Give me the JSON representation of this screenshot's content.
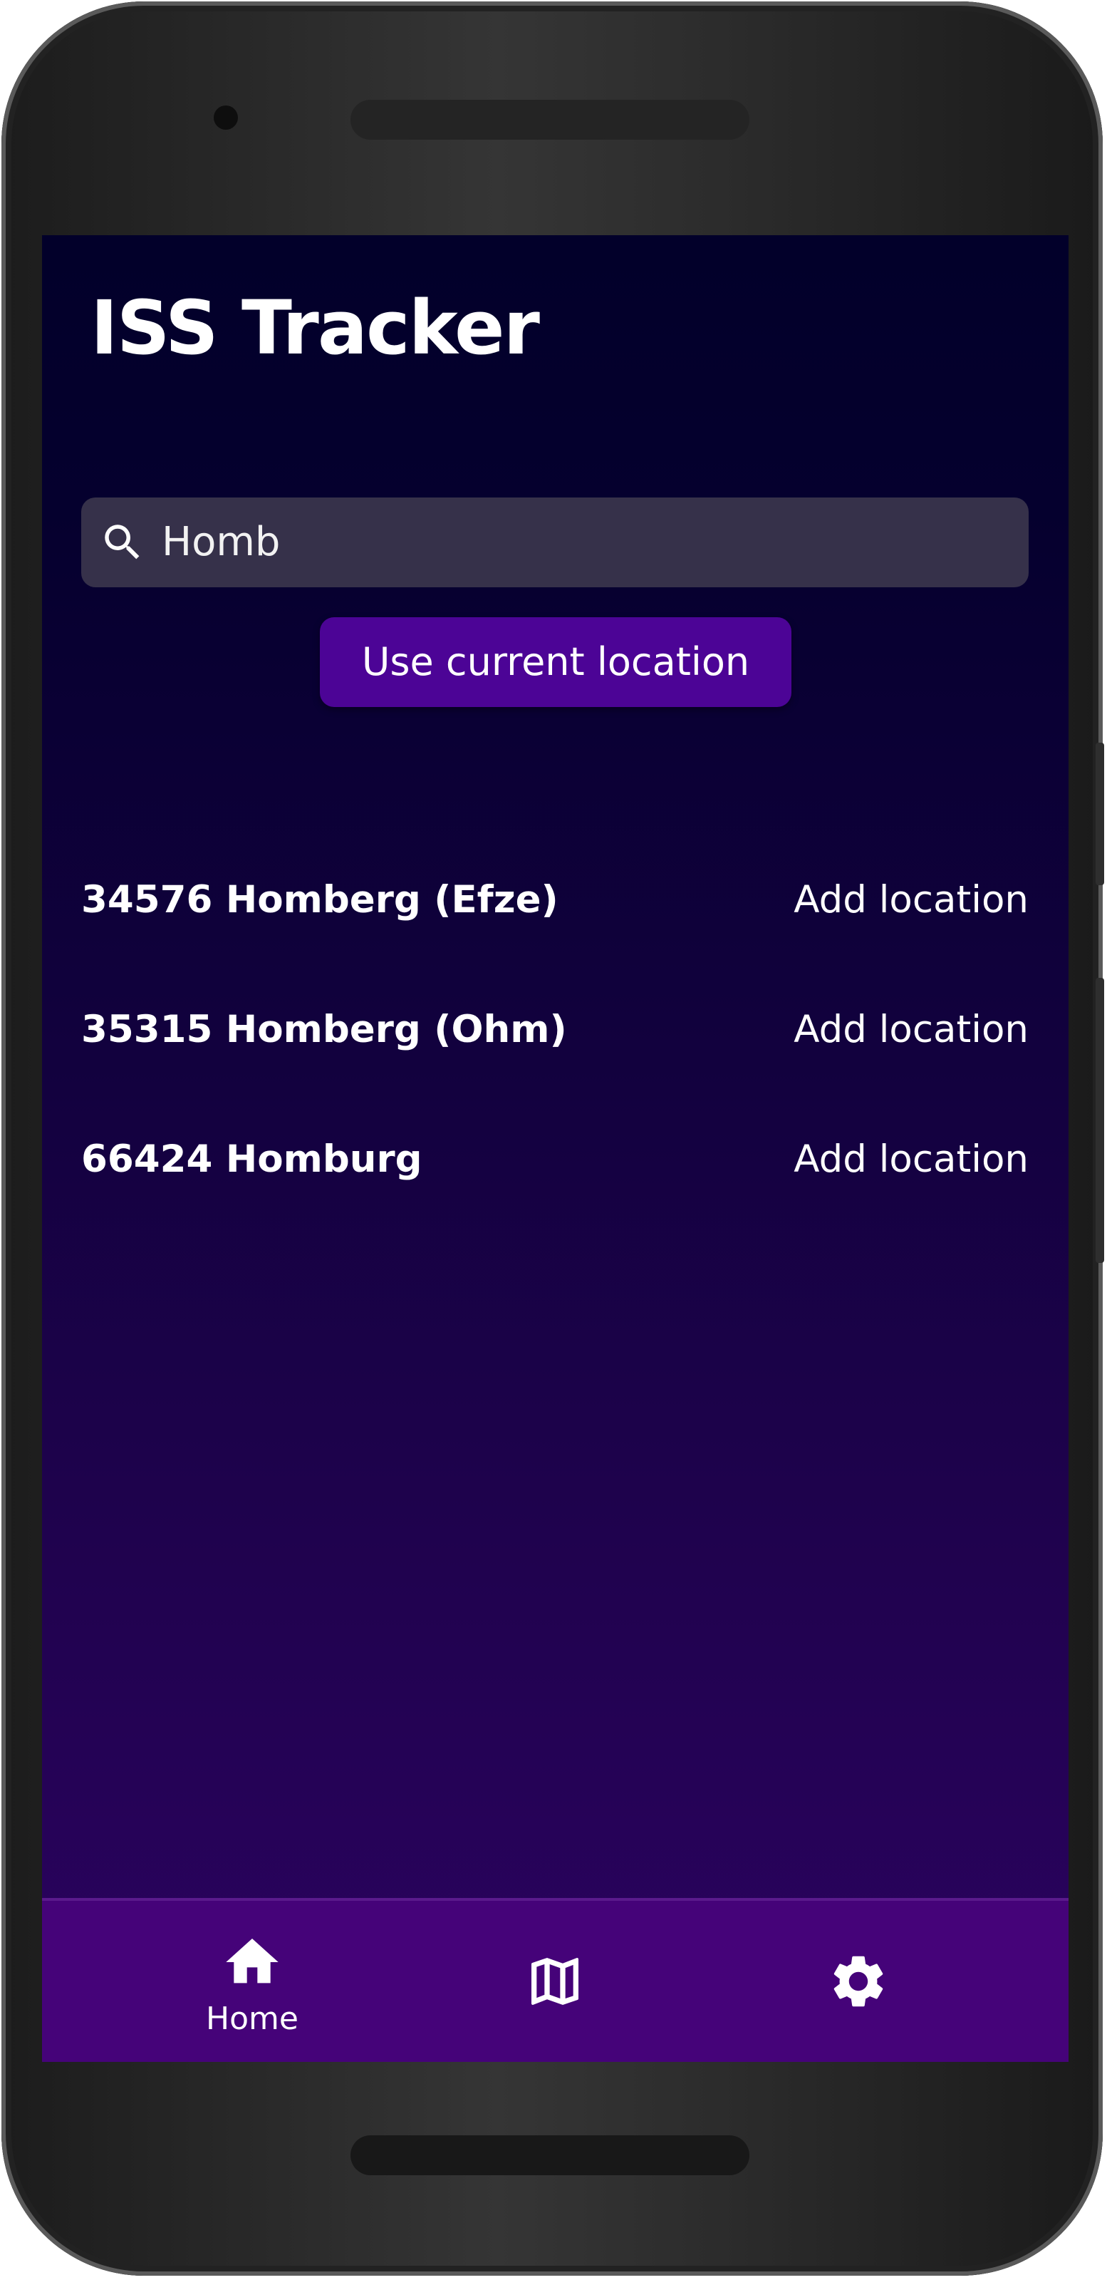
{
  "app": {
    "title": "ISS Tracker"
  },
  "search": {
    "value": "Homb",
    "icon": "search-icon"
  },
  "current_location_button": {
    "label": "Use current location"
  },
  "results": [
    {
      "name": "34576 Homberg (Efze)",
      "action": "Add location"
    },
    {
      "name": "35315 Homberg (Ohm)",
      "action": "Add location"
    },
    {
      "name": "66424 Homburg",
      "action": "Add location"
    }
  ],
  "bottom_nav": {
    "items": [
      {
        "icon": "home-icon",
        "label": "Home",
        "active": true
      },
      {
        "icon": "map-icon",
        "label": "",
        "active": false
      },
      {
        "icon": "gear-icon",
        "label": "",
        "active": false
      }
    ]
  },
  "colors": {
    "background_top": "#02002a",
    "background_bottom": "#2b0360",
    "accent": "#4c0496",
    "nav_bar": "#450379",
    "search_field": "#36314a",
    "text": "#ffffff"
  }
}
